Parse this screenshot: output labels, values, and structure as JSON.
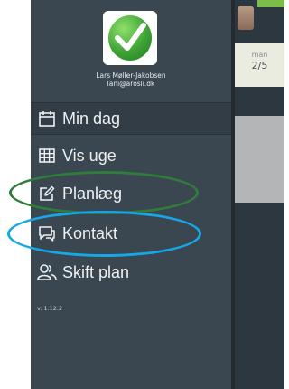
{
  "profile": {
    "name": "Lars Møller-Jakobsen",
    "email": "lani@arosli.dk"
  },
  "nav": {
    "items": [
      {
        "label": "Min dag",
        "icon": "calendar-icon"
      },
      {
        "label": "Vis uge",
        "icon": "grid-icon"
      },
      {
        "label": "Planlæg",
        "icon": "edit-icon"
      },
      {
        "label": "Kontakt",
        "icon": "chat-icon"
      },
      {
        "label": "Skift plan",
        "icon": "users-icon"
      }
    ]
  },
  "version": "v. 1.12.2",
  "day_column": {
    "day_name": "man",
    "date": "2/5"
  },
  "colors": {
    "sidebar_bg": "#3a4650",
    "highlight_green": "#2f7d3a",
    "highlight_blue": "#16a7e6"
  }
}
